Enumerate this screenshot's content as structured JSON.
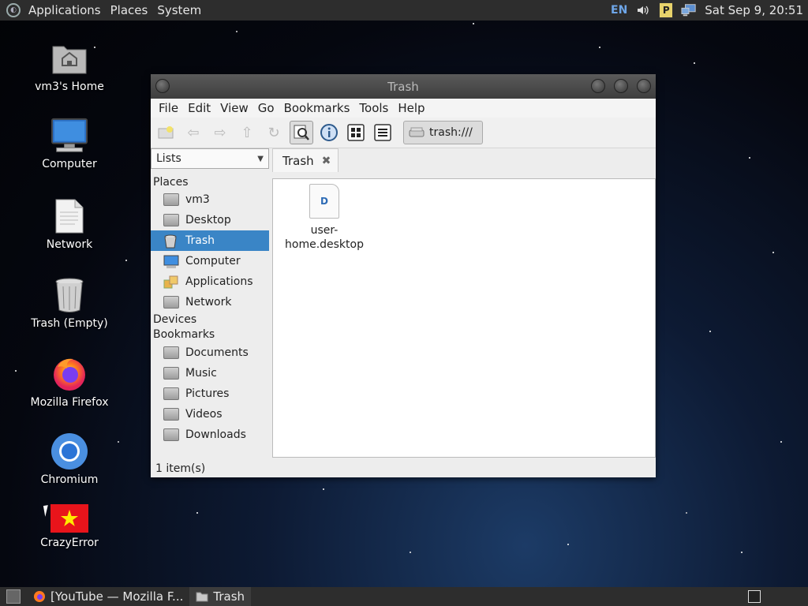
{
  "top_panel": {
    "menus": [
      "Applications",
      "Places",
      "System"
    ],
    "tray": {
      "language": "EN",
      "volume_icon": "speaker-icon",
      "p_badge": "P",
      "network_icon": "network-icon",
      "clock": "Sat Sep  9, 20:51"
    }
  },
  "desktop_icons": [
    {
      "label": "vm3's Home",
      "icon": "home-folder-icon"
    },
    {
      "label": "Computer",
      "icon": "computer-icon"
    },
    {
      "label": "Network",
      "icon": "network-file-icon"
    },
    {
      "label": "Trash (Empty)",
      "icon": "trash-icon"
    },
    {
      "label": "Mozilla Firefox",
      "icon": "firefox-icon"
    },
    {
      "label": "Chromium",
      "icon": "chromium-icon"
    },
    {
      "label": "CrazyError",
      "icon": "vietnam-flag-icon"
    }
  ],
  "window": {
    "title": "Trash",
    "menus": [
      "File",
      "Edit",
      "View",
      "Go",
      "Bookmarks",
      "Tools",
      "Help"
    ],
    "location": "trash:///",
    "sidebar": {
      "selector": "Lists",
      "places_heading": "Places",
      "places": [
        "vm3",
        "Desktop",
        "Trash",
        "Computer",
        "Applications",
        "Network"
      ],
      "selected": "Trash",
      "devices_heading": "Devices",
      "bookmarks_heading": "Bookmarks",
      "bookmarks": [
        "Documents",
        "Music",
        "Pictures",
        "Videos",
        "Downloads"
      ]
    },
    "tab": {
      "label": "Trash",
      "close": "✖"
    },
    "files": [
      {
        "name_line1": "user-",
        "name_line2": "home.desktop"
      }
    ],
    "status": "1 item(s)"
  },
  "taskbar": {
    "tasks": [
      {
        "label": "[YouTube — Mozilla F...",
        "icon": "firefox-icon"
      },
      {
        "label": "Trash",
        "icon": "folder-icon"
      }
    ]
  },
  "colors": {
    "panel": "#2d2d2d",
    "selection": "#3a85c6",
    "lang": "#6ea6e8"
  }
}
